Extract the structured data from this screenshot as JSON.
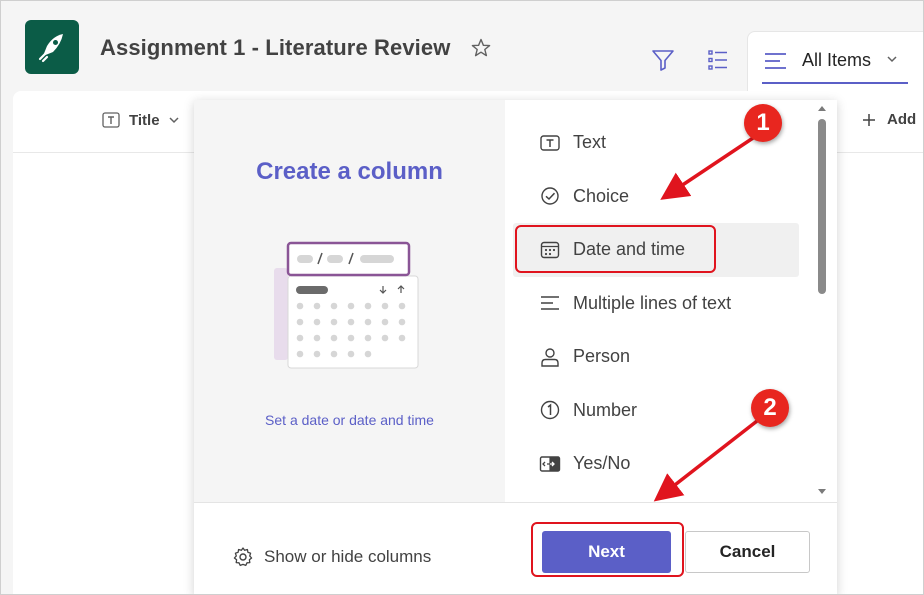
{
  "header": {
    "title": "Assignment 1 - Literature Review",
    "view_tab": "All Items"
  },
  "grid": {
    "columns": [
      "Title"
    ],
    "add_column": "Add"
  },
  "dialog": {
    "title": "Create a column",
    "caption": "Set a date or date and time",
    "column_types": [
      {
        "label": "Text",
        "icon": "text-type-icon"
      },
      {
        "label": "Choice",
        "icon": "choice-icon"
      },
      {
        "label": "Date and time",
        "icon": "calendar-icon"
      },
      {
        "label": "Multiple lines of text",
        "icon": "multiline-icon"
      },
      {
        "label": "Person",
        "icon": "person-icon"
      },
      {
        "label": "Number",
        "icon": "number-icon"
      },
      {
        "label": "Yes/No",
        "icon": "yes-no-icon"
      }
    ],
    "selected_type": "Date and time",
    "show_hide": "Show or hide columns",
    "next_label": "Next",
    "cancel_label": "Cancel"
  },
  "annotations": {
    "badge_1": "1",
    "badge_2": "2",
    "color": "#e0141e"
  },
  "colors": {
    "accent": "#5b5fc7",
    "app_icon": "#0b5c47"
  }
}
